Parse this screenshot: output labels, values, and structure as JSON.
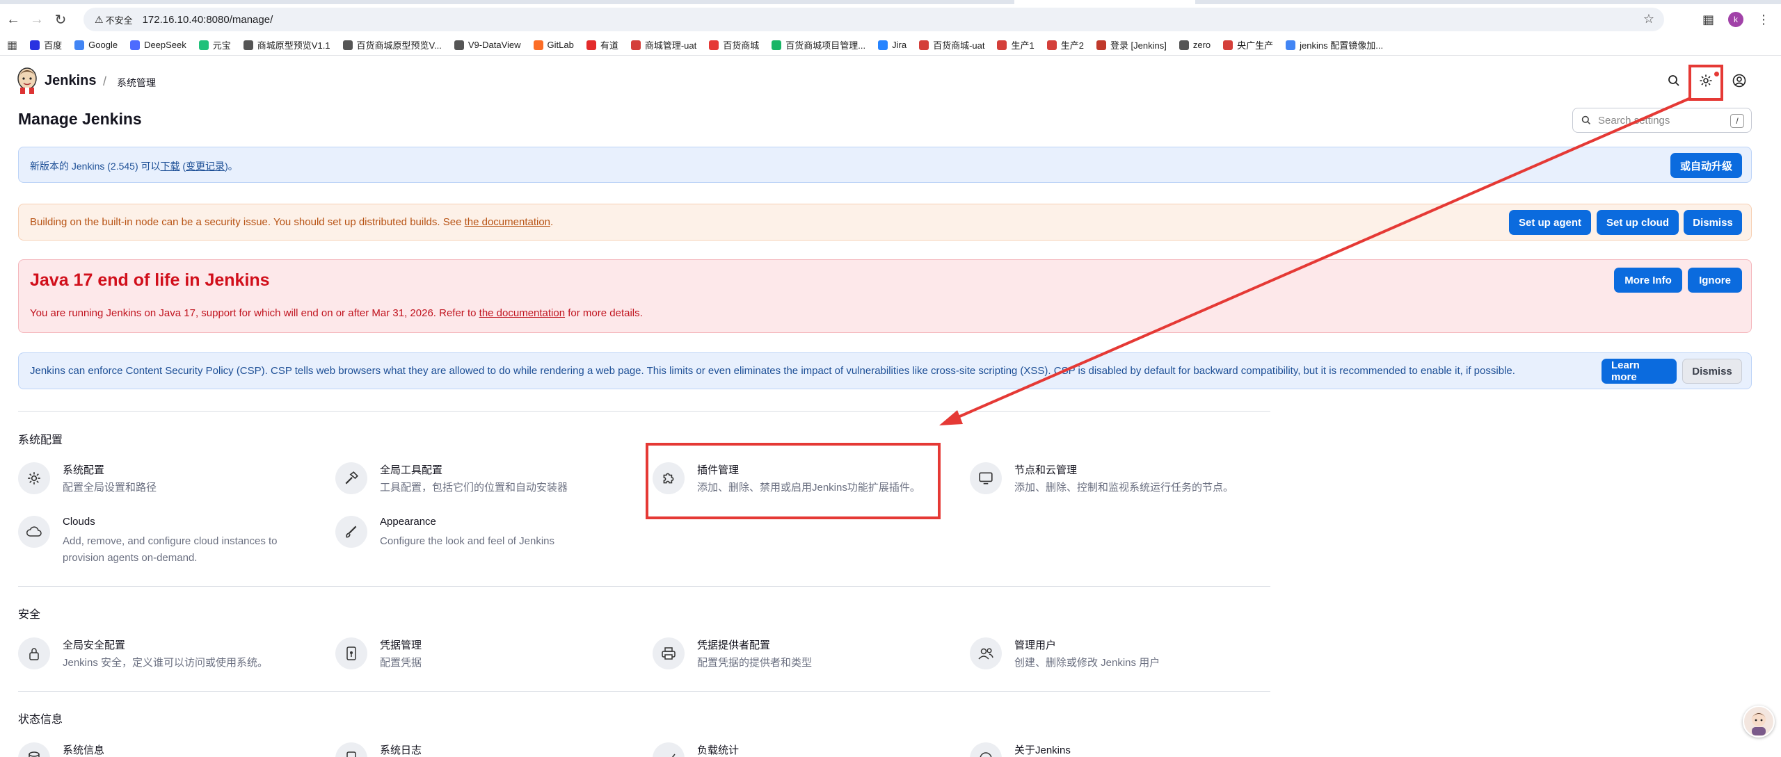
{
  "browser": {
    "security_label": "不安全",
    "url": "172.16.10.40:8080/manage/",
    "profile_initial": "k",
    "bookmarks": [
      {
        "label": "百度",
        "color": "#2932e1"
      },
      {
        "label": "Google",
        "color": "#4285f4"
      },
      {
        "label": "DeepSeek",
        "color": "#4d6bfe"
      },
      {
        "label": "元宝",
        "color": "#21c17a"
      },
      {
        "label": "商城原型预览V1.1",
        "color": "#555555"
      },
      {
        "label": "百货商城原型预览V...",
        "color": "#555555"
      },
      {
        "label": "V9-DataView",
        "color": "#555555"
      },
      {
        "label": "GitLab",
        "color": "#fc6d26"
      },
      {
        "label": "有道",
        "color": "#e32b2b"
      },
      {
        "label": "商城管理-uat",
        "color": "#d43f3a"
      },
      {
        "label": "百货商城",
        "color": "#e53935"
      },
      {
        "label": "百货商城项目管理...",
        "color": "#18b566"
      },
      {
        "label": "Jira",
        "color": "#2684ff"
      },
      {
        "label": "百货商城-uat",
        "color": "#d43f3a"
      },
      {
        "label": "生产1",
        "color": "#d43f3a"
      },
      {
        "label": "生产2",
        "color": "#d43f3a"
      },
      {
        "label": "登录 [Jenkins]",
        "color": "#c0392b"
      },
      {
        "label": "zero",
        "color": "#555555"
      },
      {
        "label": "央广生产",
        "color": "#d43f3a"
      },
      {
        "label": "jenkins 配置镜像加...",
        "color": "#4285f4"
      }
    ]
  },
  "header": {
    "brand": "Jenkins",
    "breadcrumb": "系统管理"
  },
  "page": {
    "title": "Manage Jenkins",
    "search_placeholder": "Search settings",
    "search_shortcut": "/"
  },
  "banners": {
    "update": {
      "text_before": "新版本的 Jenkins (2.545) 可以",
      "download_link": "下载",
      "text_mid": " (",
      "changelog_link": "变更记录",
      "text_after": ")。",
      "button": "或自动升级"
    },
    "builtin": {
      "text": "Building on the built-in node can be a security issue. You should set up distributed builds. See ",
      "link": "the documentation",
      "text_after": ".",
      "buttons": [
        "Set up agent",
        "Set up cloud",
        "Dismiss"
      ]
    },
    "java": {
      "heading": "Java 17 end of life in Jenkins",
      "text": "You are running Jenkins on Java 17, support for which will end on or after Mar 31, 2026. Refer to ",
      "link": "the documentation",
      "text_after": " for more details.",
      "buttons": [
        "More Info",
        "Ignore"
      ]
    },
    "csp": {
      "text": "Jenkins can enforce Content Security Policy (CSP). CSP tells web browsers what they are allowed to do while rendering a web page. This limits or even eliminates the impact of vulnerabilities like cross-site scripting (XSS). CSP is disabled by default for backward compatibility, but it is recommended to enable it, if possible.",
      "buttons": [
        "Learn more",
        "Dismiss"
      ]
    }
  },
  "sections": [
    {
      "title": "系统配置",
      "items": [
        {
          "name": "系统配置",
          "desc": "配置全局设置和路径",
          "icon": "gear-icon"
        },
        {
          "name": "全局工具配置",
          "desc": "工具配置，包括它们的位置和自动安装器",
          "icon": "hammer-icon"
        },
        {
          "name": "插件管理",
          "desc": "添加、删除、禁用或启用Jenkins功能扩展插件。",
          "icon": "puzzle-icon"
        },
        {
          "name": "节点和云管理",
          "desc": "添加、删除、控制和监视系统运行任务的节点。",
          "icon": "monitor-icon"
        },
        {
          "name": "Clouds",
          "desc": "Add, remove, and configure cloud instances to provision agents on-demand.",
          "icon": "cloud-icon"
        },
        {
          "name": "Appearance",
          "desc": "Configure the look and feel of Jenkins",
          "icon": "brush-icon"
        }
      ]
    },
    {
      "title": "安全",
      "items": [
        {
          "name": "全局安全配置",
          "desc": "Jenkins 安全，定义谁可以访问或使用系统。",
          "icon": "lock-icon"
        },
        {
          "name": "凭据管理",
          "desc": "配置凭据",
          "icon": "phone-key-icon"
        },
        {
          "name": "凭据提供者配置",
          "desc": "配置凭据的提供者和类型",
          "icon": "printer-icon"
        },
        {
          "name": "管理用户",
          "desc": "创建、删除或修改 Jenkins 用户",
          "icon": "users-icon"
        }
      ]
    },
    {
      "title": "状态信息",
      "items": [
        {
          "name": "系统信息",
          "desc": "",
          "icon": "database-icon"
        },
        {
          "name": "系统日志",
          "desc": "",
          "icon": "log-icon"
        },
        {
          "name": "负载统计",
          "desc": "",
          "icon": "chart-icon"
        },
        {
          "name": "关于Jenkins",
          "desc": "",
          "icon": "info-icon"
        }
      ]
    }
  ],
  "colors": {
    "primary_button": "#0b6bde",
    "annotation_red": "#e53935",
    "error_text": "#d10f1b",
    "warning_text": "#b75213"
  }
}
